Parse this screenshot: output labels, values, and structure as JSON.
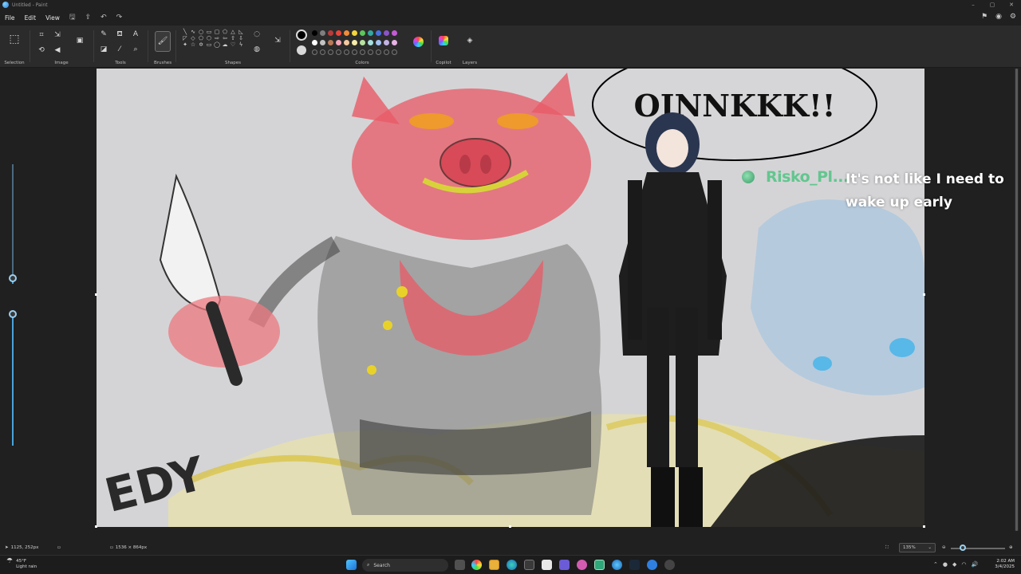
{
  "window": {
    "title": "Untitled - Paint"
  },
  "window_controls": {
    "minimize": "–",
    "maximize": "▢",
    "close": "✕"
  },
  "menu": {
    "file": "File",
    "edit": "Edit",
    "view": "View"
  },
  "ribbon": {
    "groups": {
      "selection": "Selection",
      "image": "Image",
      "tools": "Tools",
      "brushes": "Brushes",
      "shapes": "Shapes",
      "colors": "Colors",
      "copilot": "Copilot",
      "layers": "Layers"
    },
    "palette_row1": [
      "#000000",
      "#7f7f7f",
      "#b83b3b",
      "#e8453c",
      "#f28c38",
      "#f5d43c",
      "#5cc75a",
      "#34a8a0",
      "#4a6fe0",
      "#8b53c9",
      "#c45bd6"
    ],
    "palette_row2": [
      "#ffffff",
      "#c3c3c3",
      "#b97a57",
      "#f4a6b8",
      "#f6c89f",
      "#f6eaa7",
      "#b6e2a0",
      "#a5dfe0",
      "#a4c2f4",
      "#c3b2e6",
      "#e9b3e6"
    ],
    "primary_color": "#000000",
    "secondary_color": "#d9d9d9"
  },
  "canvas": {
    "speech_bubble_text": "OINNKKK!!",
    "signature": "EDY",
    "background": "#d4d4d6"
  },
  "chat_overlay": {
    "username": "Risko_Pl...",
    "message": "It's not like I need to wake up early",
    "username_color": "#62c68f"
  },
  "statusbar": {
    "cursor_position": "1125, 252px",
    "canvas_size": "1536 × 864px",
    "zoom": "135%"
  },
  "taskbar": {
    "weather_temp": "45°F",
    "weather_desc": "Light rain",
    "search_placeholder": "Search",
    "time": "2:02 AM",
    "date": "3/4/2025"
  }
}
